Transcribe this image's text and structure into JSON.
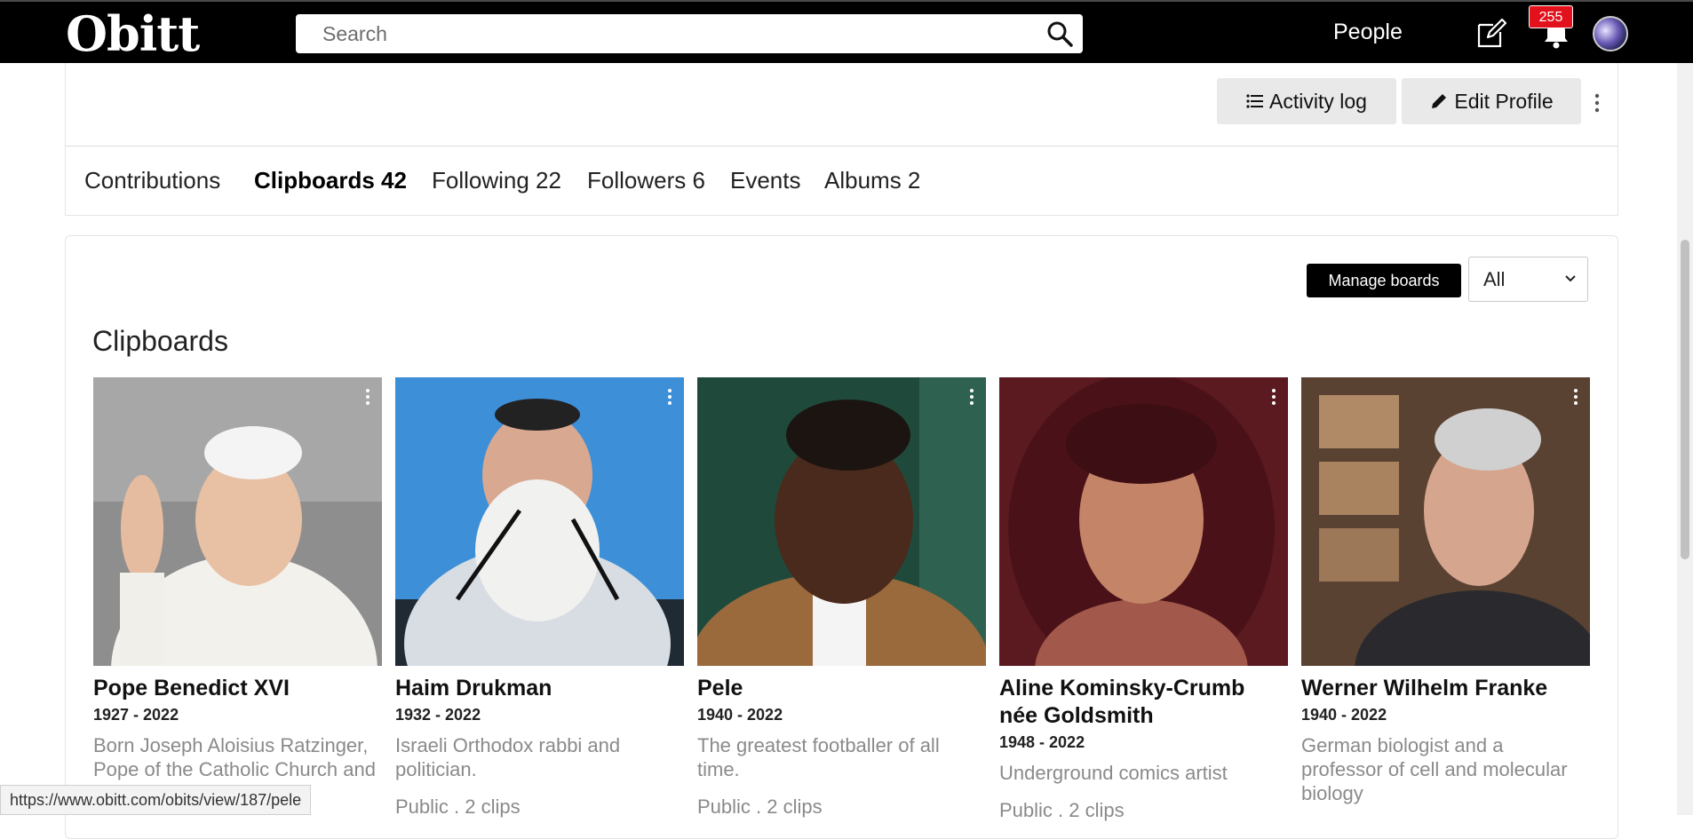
{
  "header": {
    "logo": "Obitt",
    "search_placeholder": "Search",
    "people_link": "People",
    "notification_count": "255",
    "icons": {
      "search": "search-icon",
      "compose": "edit-icon",
      "notifications": "bell-icon"
    }
  },
  "profile": {
    "activity_log_label": "Activity log",
    "edit_profile_label": "Edit Profile"
  },
  "tabs": [
    {
      "label": "Contributions",
      "active": false
    },
    {
      "label": "Clipboards 42",
      "active": true
    },
    {
      "label": "Following 22",
      "active": false
    },
    {
      "label": "Followers 6",
      "active": false
    },
    {
      "label": "Events",
      "active": false
    },
    {
      "label": "Albums 2",
      "active": false
    }
  ],
  "clipboards": {
    "manage_label": "Manage boards",
    "filter_value": "All",
    "title": "Clipboards",
    "boards": [
      {
        "name": "Pope Benedict XVI",
        "years": "1927 - 2022",
        "desc": "Born Joseph Aloisius Ratzinger, Pope of the Catholic Church and sovereign of the Vatican",
        "meta": ""
      },
      {
        "name": "Haim Drukman",
        "years": "1932 - 2022",
        "desc": "Israeli Orthodox rabbi and politician.",
        "meta": "Public . 2 clips"
      },
      {
        "name": "Pele",
        "years": "1940 - 2022",
        "desc": "The greatest footballer of all time.",
        "meta": "Public . 2 clips"
      },
      {
        "name": "Aline Kominsky-Crumb née Goldsmith",
        "years": "1948 - 2022",
        "desc": "Underground comics artist",
        "meta": "Public . 2 clips"
      },
      {
        "name": "Werner Wilhelm Franke",
        "years": "1940 - 2022",
        "desc": "German biologist and a professor of cell and molecular biology",
        "meta": ""
      }
    ]
  },
  "status_url": "https://www.obitt.com/obits/view/187/pele",
  "colors": {
    "topbar": "#000000",
    "badge": "#e3111b",
    "button_dark": "#000000",
    "button_grey": "#e9e9e9"
  }
}
